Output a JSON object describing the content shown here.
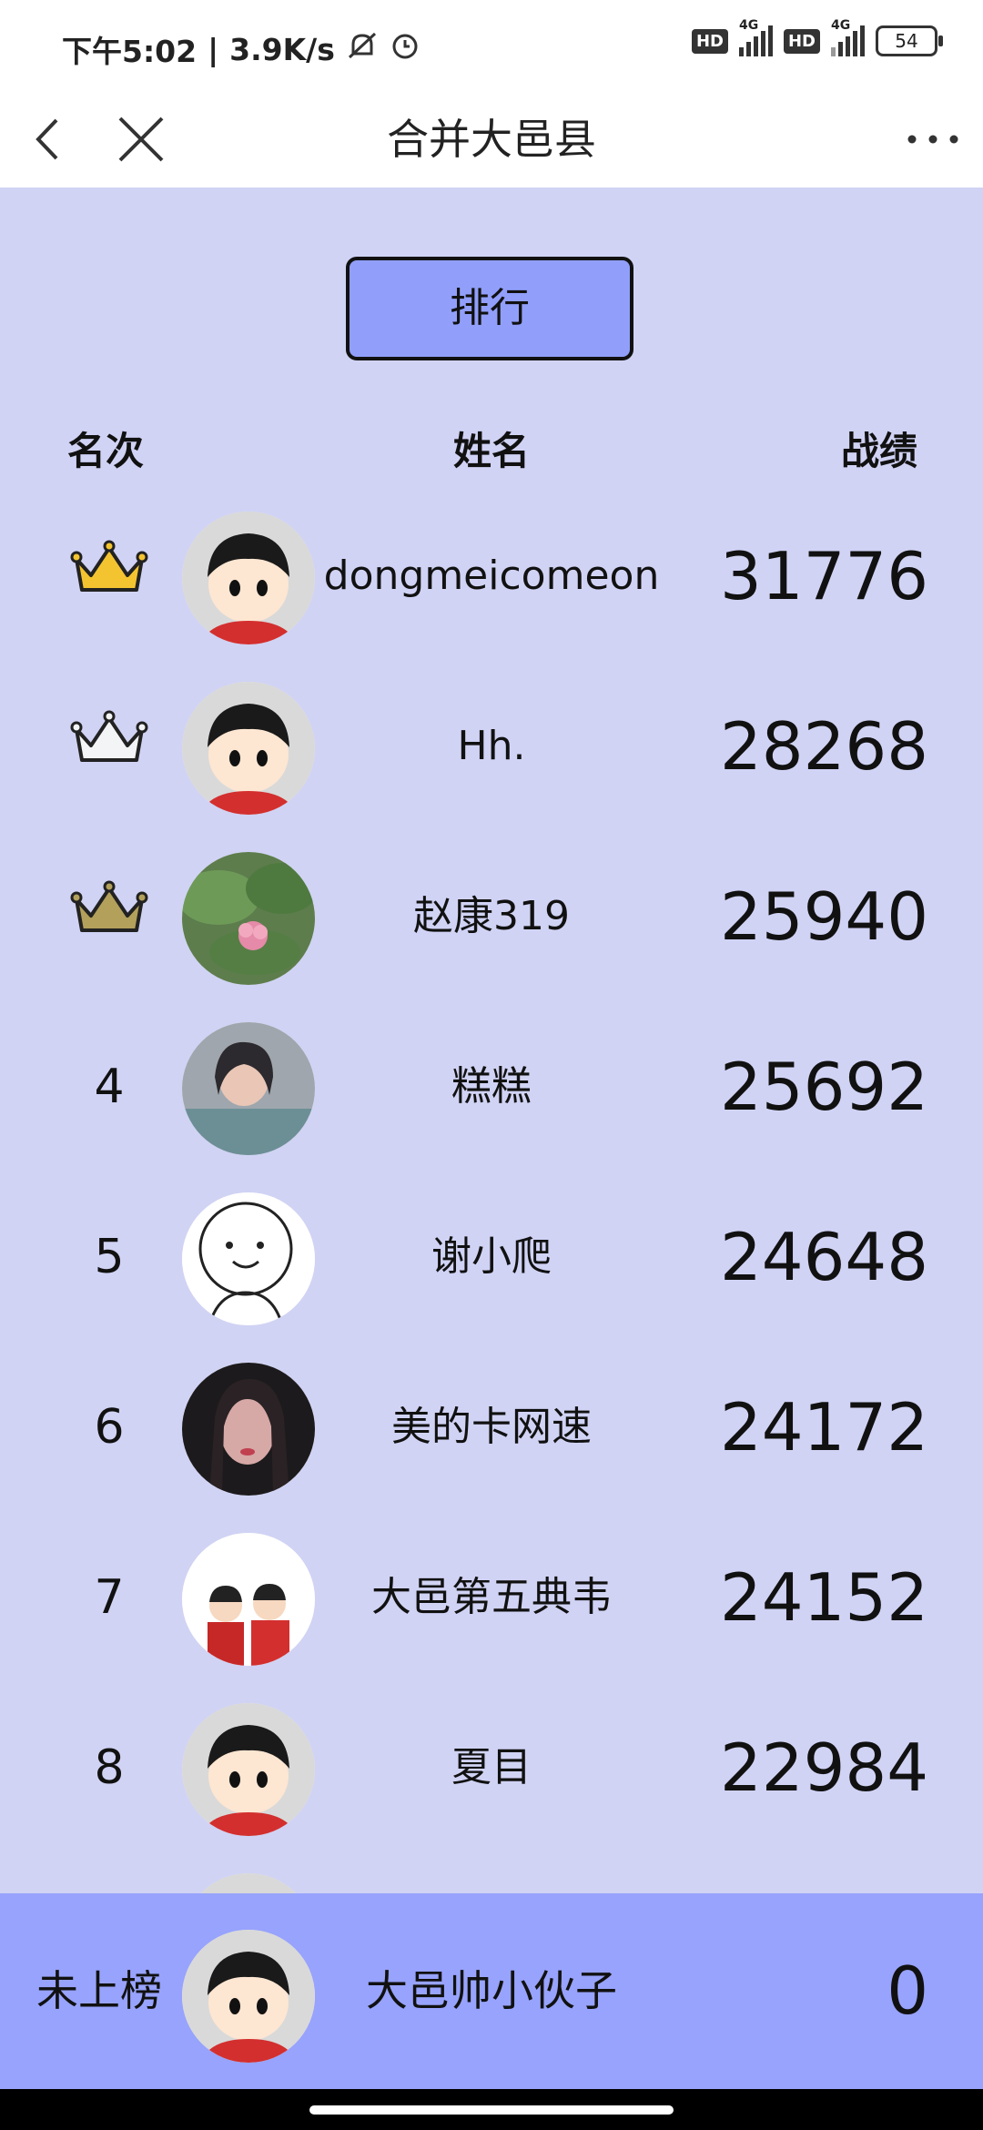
{
  "status": {
    "time": "下午5:02",
    "speed": "3.9K/s",
    "battery": "54",
    "net1": "4G",
    "net2": "4G",
    "hd": "HD"
  },
  "nav": {
    "title": "合并大邑县"
  },
  "tabs": {
    "rank_button": "排行"
  },
  "table": {
    "headers": {
      "rank": "名次",
      "name": "姓名",
      "score": "战绩"
    },
    "rows": [
      {
        "rank": "",
        "icon": "gold-crown-icon",
        "name": "dongmeicomeon",
        "score": "31776",
        "avatar": "cartoon-boy"
      },
      {
        "rank": "",
        "icon": "silver-crown-icon",
        "name": "Hh.",
        "score": "28268",
        "avatar": "cartoon-boy"
      },
      {
        "rank": "",
        "icon": "bronze-crown-icon",
        "name": "赵康319",
        "score": "25940",
        "avatar": "lotus-photo"
      },
      {
        "rank": "4",
        "name": "糕糕",
        "score": "25692",
        "avatar": "girl-photo"
      },
      {
        "rank": "5",
        "name": "谢小爬",
        "score": "24648",
        "avatar": "smiley-sketch"
      },
      {
        "rank": "6",
        "name": "美的卡网速",
        "score": "24172",
        "avatar": "dark-girl-photo"
      },
      {
        "rank": "7",
        "name": "大邑第五典韦",
        "score": "24152",
        "avatar": "couple-cartoon"
      },
      {
        "rank": "8",
        "name": "夏目",
        "score": "22984",
        "avatar": "cartoon-boy"
      }
    ]
  },
  "mine": {
    "rank": "未上榜",
    "name": "大邑帅小伙子",
    "score": "0"
  },
  "colors": {
    "background": "#d0d3f4",
    "accent": "#919ffb",
    "footer": "#97a3fc"
  }
}
